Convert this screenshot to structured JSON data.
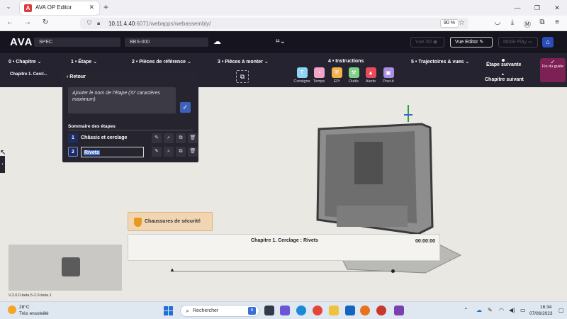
{
  "browser": {
    "tab_title": "AVA OP Editor",
    "url_host": "10.11.4.40",
    "url_path": ":6071/webapps/webassembly/",
    "zoom": "90 %"
  },
  "appbar": {
    "logo": "AVA",
    "project": "SPEC",
    "assembly": "BBS-000",
    "vue3d": "Vue 3D",
    "vue_editor": "Vue Editor",
    "mode_play": "Mode Play"
  },
  "stepbar": {
    "chapitre": "0 • Chapitre",
    "chapitre_sub": "Chapitre 1. Cercl...",
    "etape": "1 • Étape",
    "pieces_ref": "2 • Pièces de référence",
    "pieces_monter": "3 • Pièces à monter",
    "instructions_title": "4 • Instructions",
    "instructions": [
      {
        "label": "Consigne",
        "icon": "T",
        "color": "#8fd3f5"
      },
      {
        "label": "Temps",
        "icon": "◔",
        "color": "#f2a3c7"
      },
      {
        "label": "EPI",
        "icon": "⛨",
        "color": "#f0b24a"
      },
      {
        "label": "Outils",
        "icon": "⚒",
        "color": "#7fcf87"
      },
      {
        "label": "Alerte",
        "icon": "▲",
        "color": "#e94a5b"
      },
      {
        "label": "Post-it",
        "icon": "▣",
        "color": "#a98de0"
      }
    ],
    "trajectoires": "5 • Trajectoires & vues",
    "etape_suivante": "Étape suivante",
    "chapitre_suivant": "Chapitre suivant",
    "fin_du_guide": "Fin du guide"
  },
  "panel": {
    "back": "Retour",
    "placeholder": "Ajouter le nom de l'étape (37 caractères maximum)",
    "summary_title": "Sommaire des étapes",
    "steps": [
      {
        "num": "1",
        "name": "Châssis et cerclage"
      },
      {
        "num": "2",
        "name": "Rivets"
      }
    ]
  },
  "workspace": {
    "safety_label": "Chaussures de sécurité",
    "banner_title": "Chapitre 1. Cerclage : Rivets",
    "timer": "00:00:00",
    "version": "V.2.0.0-beta.5-2.0-beta.1"
  },
  "taskbar": {
    "temperature": "28°C",
    "weather": "Très ensoleillé",
    "search_placeholder": "Rechercher",
    "time": "16:34",
    "date": "07/06/2023"
  }
}
